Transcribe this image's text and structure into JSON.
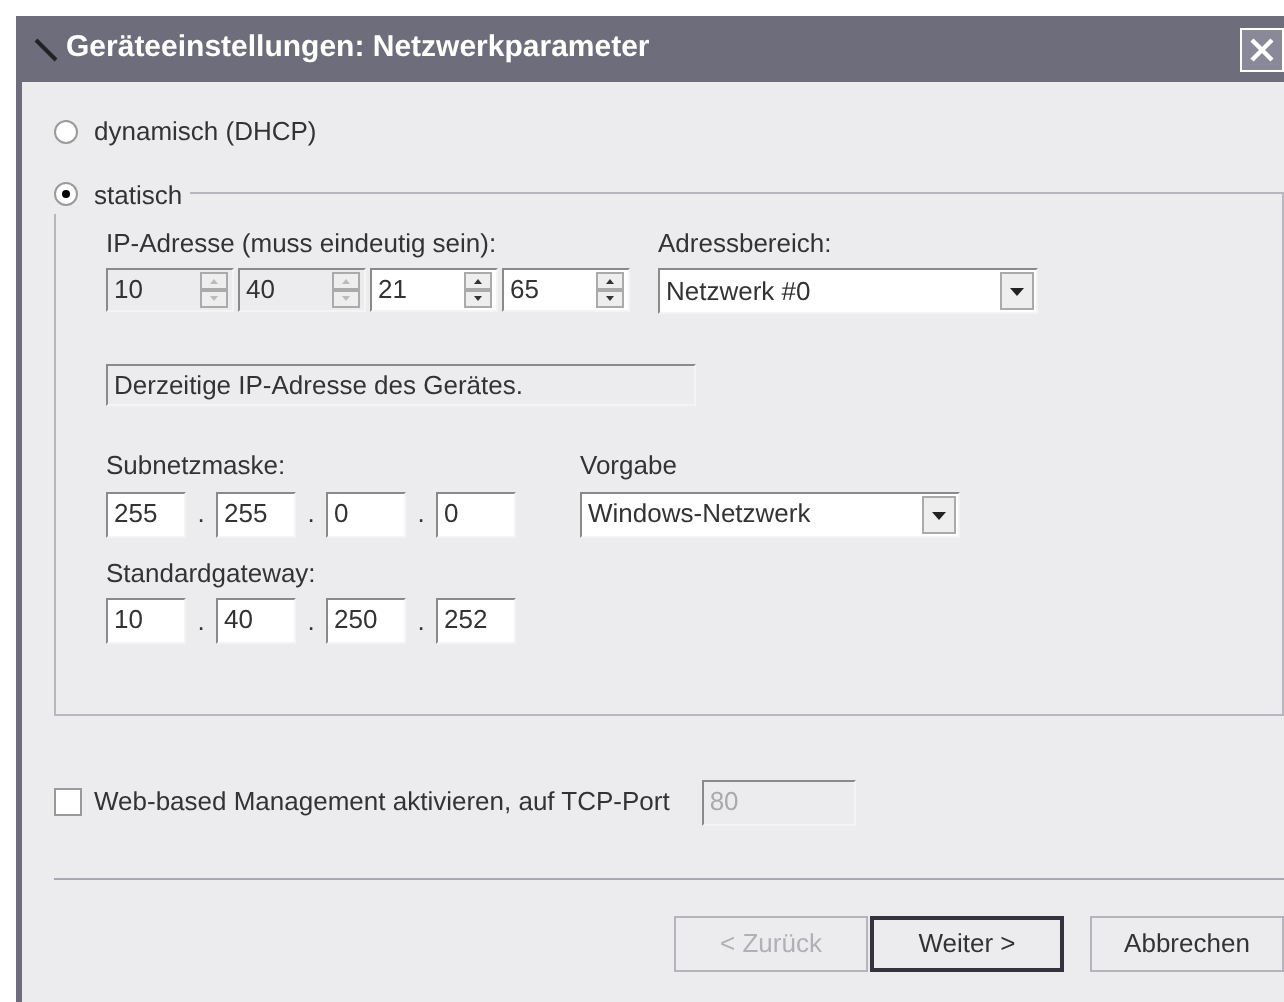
{
  "window": {
    "title": "Geräteeinstellungen: Netzwerkparameter"
  },
  "mode_options": [
    {
      "label": "dynamisch (DHCP)",
      "selected": false
    },
    {
      "label": "statisch",
      "selected": true
    }
  ],
  "ip_address": {
    "label": "IP-Adresse (muss eindeutig sein):",
    "octets": [
      {
        "value": "10",
        "disabled": true
      },
      {
        "value": "40",
        "disabled": true
      },
      {
        "value": "21",
        "disabled": false
      },
      {
        "value": "65",
        "disabled": false
      }
    ]
  },
  "address_range": {
    "label": "Adressbereich:",
    "value": "Netzwerk #0"
  },
  "info_field": {
    "value": "Derzeitige IP-Adresse des Gerätes."
  },
  "subnet_mask": {
    "label": "Subnetzmaske:",
    "octets": [
      "255",
      "255",
      "0",
      "0"
    ],
    "separator": "."
  },
  "preset": {
    "label": "Vorgabe",
    "value": "Windows-Netzwerk"
  },
  "gateway": {
    "label": "Standardgateway:",
    "octets": [
      "10",
      "40",
      "250",
      "252"
    ],
    "separator": "."
  },
  "web_management": {
    "label": "Web-based Management aktivieren, auf TCP-Port",
    "checked": false,
    "port": "80"
  },
  "buttons": [
    {
      "label": "< Zurück",
      "disabled": true,
      "default": false
    },
    {
      "label": "Weiter >",
      "disabled": false,
      "default": true
    },
    {
      "label": "Abbrechen",
      "disabled": false,
      "default": false
    }
  ]
}
